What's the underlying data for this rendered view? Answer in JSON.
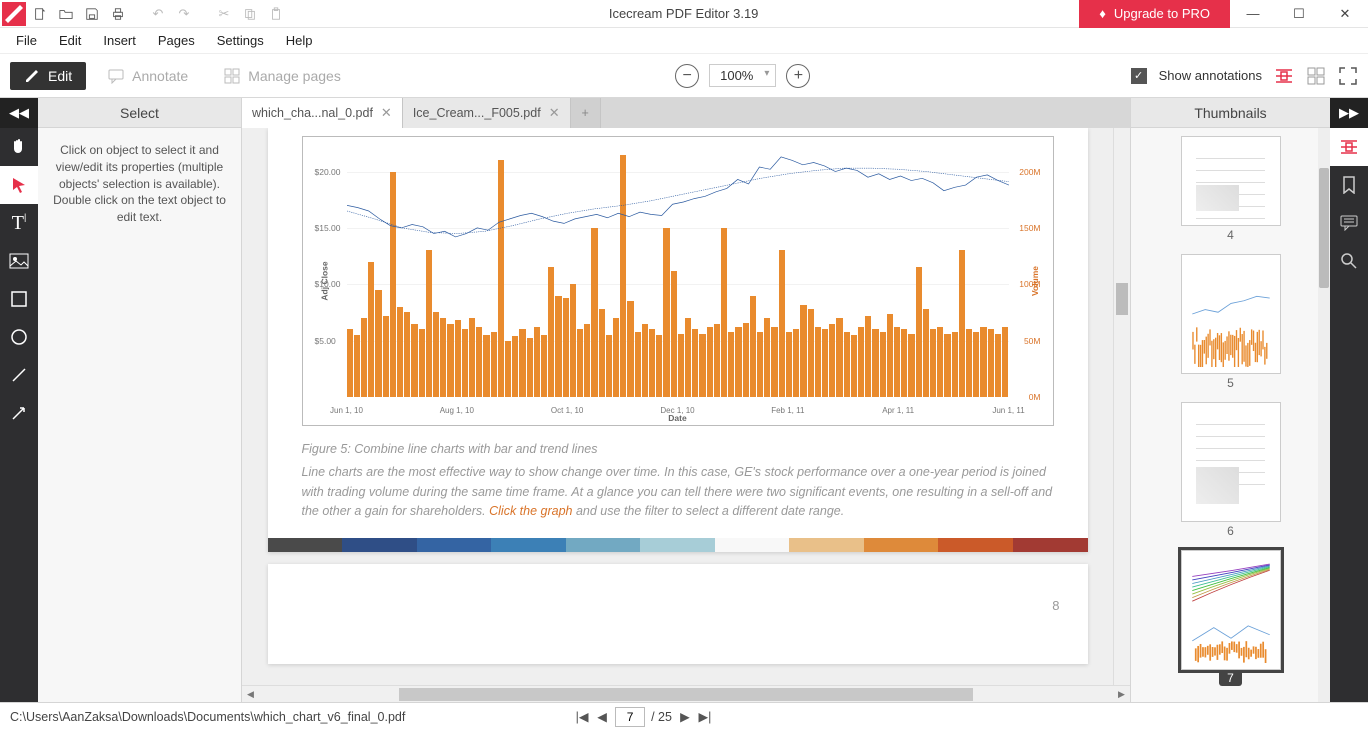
{
  "titlebar": {
    "app_title": "Icecream PDF Editor 3.19",
    "upgrade_label": "Upgrade to PRO"
  },
  "menubar": [
    "File",
    "Edit",
    "Insert",
    "Pages",
    "Settings",
    "Help"
  ],
  "modebar": {
    "edit": "Edit",
    "annotate": "Annotate",
    "manage": "Manage pages",
    "zoom": "100%",
    "show_annotations": "Show annotations"
  },
  "left_panel": {
    "title": "Select",
    "body": "Click on object to select it and view/edit its properties (multiple objects' selection is available). Double click on the text object to edit text."
  },
  "tabs": [
    {
      "label": "which_cha...nal_0.pdf"
    },
    {
      "label": "Ice_Cream..._F005.pdf"
    }
  ],
  "page": {
    "fig_line": "Figure 5: Combine line charts with bar and trend lines",
    "body1": "Line charts are the most effective way to show change over time. In this case, GE's stock performance over a one-year period is joined with trading volume during the same time frame. At a glance you can tell there were two significant events, one resulting in a sell-off and the other a gain for shareholders. ",
    "link": "Click the graph",
    "body2": " and use the filter to select a different date range.",
    "next_page_num": "8"
  },
  "colorbar": [
    "#4a4a4a",
    "#2f4e86",
    "#3464a3",
    "#3c80b6",
    "#72a9c2",
    "#a7cdd7",
    "#f8f8f8",
    "#e9c089",
    "#de8a3a",
    "#cb5a29",
    "#a23a33"
  ],
  "right_panel": {
    "title": "Thumbnails",
    "thumbs": [
      4,
      5,
      6,
      7
    ]
  },
  "statusbar": {
    "path": "C:\\Users\\AanZaksa\\Downloads\\Documents\\which_chart_v6_final_0.pdf",
    "page": "7",
    "total": "/ 25"
  },
  "chart_data": {
    "type": "combo-bar-line",
    "xlabel": "Date",
    "ylabel": "Adj Close",
    "ylabel2": "Volume",
    "x_ticks": [
      "Jun 1, 10",
      "Aug 1, 10",
      "Oct 1, 10",
      "Dec 1, 10",
      "Feb 1, 11",
      "Apr 1, 11",
      "Jun 1, 11"
    ],
    "y_ticks": [
      "$5.00",
      "$10.00",
      "$15.00",
      "$20.00"
    ],
    "y2_ticks": [
      "0M",
      "50M",
      "100M",
      "150M",
      "200M"
    ],
    "ylim": [
      0,
      22
    ],
    "y2lim": [
      0,
      220000000
    ],
    "series": [
      {
        "name": "Adj Close",
        "type": "line",
        "color": "#2b5aa0",
        "values": [
          17.0,
          16.8,
          16.5,
          15.8,
          15.2,
          15.0,
          15.3,
          15.1,
          14.5,
          14.7,
          14.2,
          14.5,
          15.0,
          14.8,
          15.5,
          15.8,
          16.1,
          16.3,
          16.0,
          15.6,
          15.4,
          15.8,
          16.0,
          16.2,
          15.9,
          16.3,
          16.0,
          16.4,
          16.2,
          16.1,
          17.1,
          17.3,
          17.6,
          17.8,
          18.2,
          18.5,
          19.3,
          18.9,
          20.4,
          20.2,
          21.3,
          21.0,
          20.6,
          20.8,
          20.5,
          20.0,
          20.3,
          20.1,
          19.5,
          19.8,
          19.3,
          19.6,
          19.2,
          19.4,
          19.0,
          18.3,
          18.6,
          18.8,
          19.5,
          19.7,
          19.2,
          18.8
        ]
      },
      {
        "name": "Trend",
        "type": "line-dashed",
        "color": "#2b5aa0",
        "values": [
          16.5,
          15.8,
          15.0,
          14.6,
          14.5,
          14.7,
          15.2,
          15.8,
          16.3,
          16.7,
          17.0,
          17.4,
          17.9,
          18.4,
          18.9,
          19.4,
          19.8,
          20.1,
          20.3,
          20.3,
          20.2,
          20.0,
          19.7,
          19.4,
          19.1
        ]
      },
      {
        "name": "Volume",
        "type": "bar",
        "color": "#e98b2e",
        "values": [
          60,
          55,
          70,
          120,
          95,
          72,
          200,
          80,
          75,
          65,
          60,
          130,
          75,
          70,
          65,
          68,
          60,
          70,
          62,
          55,
          58,
          210,
          50,
          54,
          60,
          52,
          62,
          55,
          115,
          90,
          88,
          100,
          60,
          65,
          150,
          78,
          55,
          70,
          215,
          85,
          58,
          65,
          60,
          55,
          150,
          112,
          56,
          70,
          60,
          56,
          62,
          65,
          150,
          58,
          62,
          66,
          90,
          58,
          70,
          62,
          130,
          58,
          60,
          82,
          78,
          62,
          60,
          65,
          70,
          58,
          55,
          62,
          72,
          60,
          58,
          74,
          62,
          60,
          56,
          115,
          78,
          60,
          62,
          56,
          58,
          130,
          60,
          58,
          62,
          60,
          56,
          62
        ]
      }
    ]
  }
}
